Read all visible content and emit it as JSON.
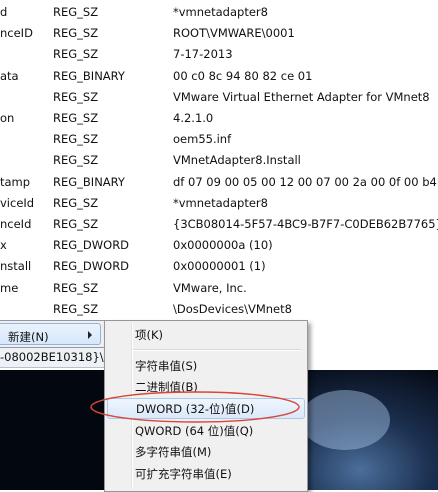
{
  "registry_values": [
    {
      "name": "d",
      "type": "REG_SZ",
      "data": "*vmnetadapter8"
    },
    {
      "name": "nceID",
      "type": "REG_SZ",
      "data": "ROOT\\VMWARE\\0001"
    },
    {
      "name": "",
      "type": "REG_SZ",
      "data": "7-17-2013"
    },
    {
      "name": "ata",
      "type": "REG_BINARY",
      "data": "00 c0 8c 94 80 82 ce 01"
    },
    {
      "name": "",
      "type": "REG_SZ",
      "data": "VMware Virtual Ethernet Adapter for VMnet8"
    },
    {
      "name": "on",
      "type": "REG_SZ",
      "data": "4.2.1.0"
    },
    {
      "name": "",
      "type": "REG_SZ",
      "data": "oem55.inf"
    },
    {
      "name": "",
      "type": "REG_SZ",
      "data": "VMnetAdapter8.Install"
    },
    {
      "name": "tamp",
      "type": "REG_BINARY",
      "data": "df 07 09 00 05 00 12 00 07 00 2a 00 0f 00 b4"
    },
    {
      "name": "viceId",
      "type": "REG_SZ",
      "data": "*vmnetadapter8"
    },
    {
      "name": "nceId",
      "type": "REG_SZ",
      "data": "{3CB08014-5F57-4BC9-B7F7-C0DEB62B7765}"
    },
    {
      "name": "x",
      "type": "REG_DWORD",
      "data": "0x0000000a (10)"
    },
    {
      "name": "nstall",
      "type": "REG_DWORD",
      "data": "0x00000001 (1)"
    },
    {
      "name": "me",
      "type": "REG_SZ",
      "data": "VMware, Inc."
    },
    {
      "name": "",
      "type": "REG_SZ",
      "data": "\\DosDevices\\VMnet8"
    }
  ],
  "context_menu": {
    "parent_item": "新建(N)",
    "submenu_items": [
      "项(K)",
      "字符串值(S)",
      "二进制值(B)",
      "DWORD (32-位)值(D)",
      "QWORD (64 位)值(Q)",
      "多字符串值(M)",
      "可扩充字符串值(E)"
    ]
  },
  "status_bar": {
    "path_text": "-08002BE10318}\\("
  },
  "annotation": {
    "color": "#d9463a"
  }
}
